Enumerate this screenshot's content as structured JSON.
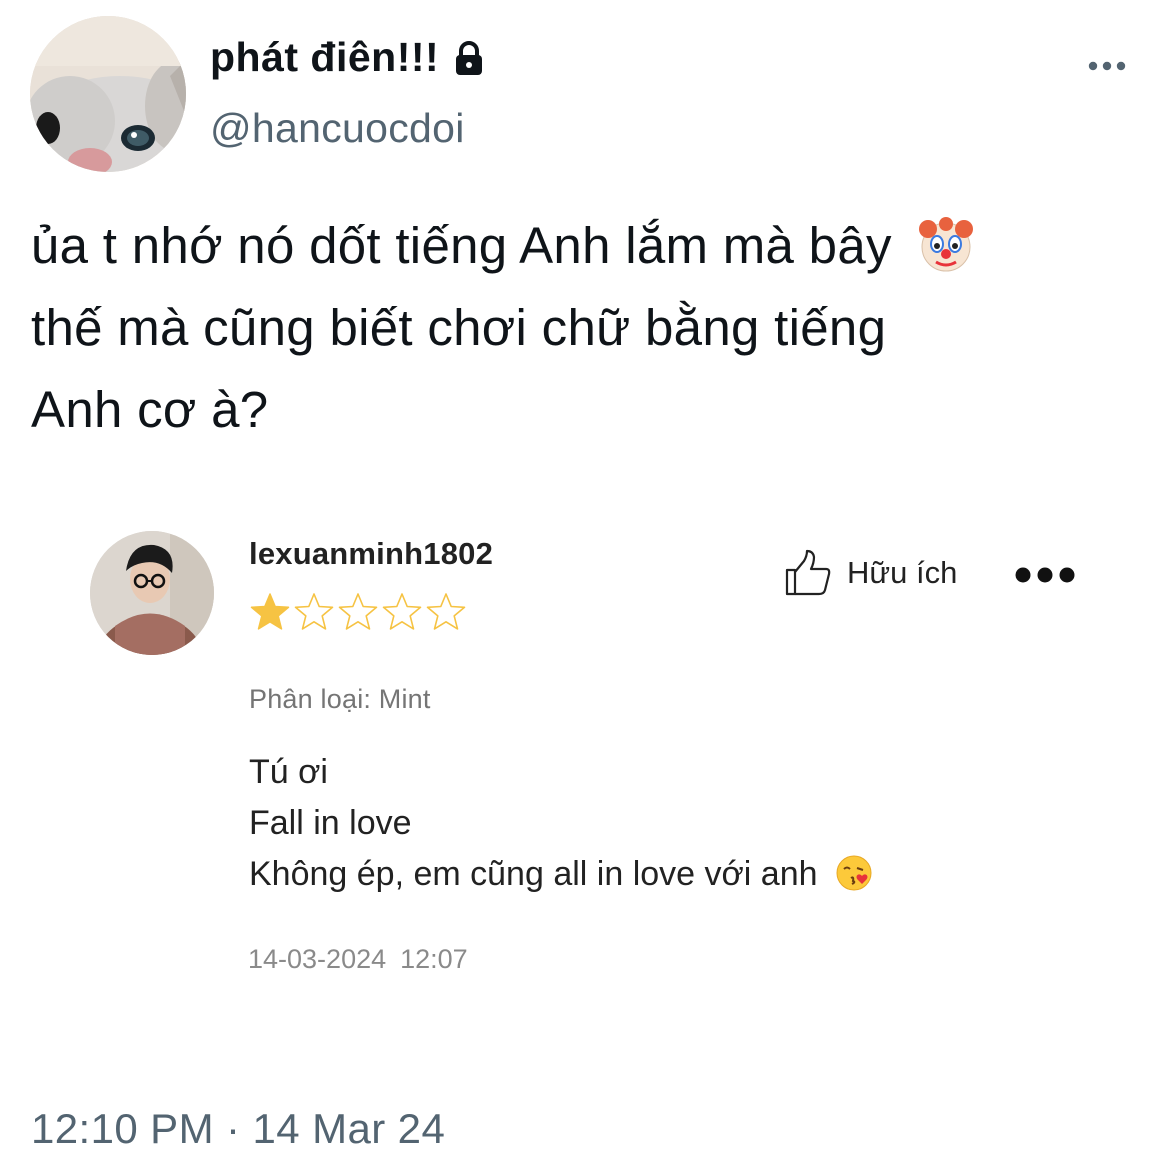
{
  "tweet": {
    "display_name": "phát điên!!!",
    "handle": "@hancuocdoi",
    "text_lines": [
      "ủa t nhớ nó dốt tiếng Anh lắm mà bây",
      "thế mà cũng biết chơi chữ bằng tiếng",
      "Anh cơ à?"
    ],
    "emoji_after_line_1": "clown-face-emoji",
    "timestamp": "12:10 PM · 14 Mar 24",
    "icons": {
      "protected": "lock-icon",
      "menu": "more-horizontal-icon"
    }
  },
  "review": {
    "username": "lexuanminh1802",
    "rating": 1,
    "max_rating": 5,
    "helpful_label": "Hữu ích",
    "variant": "Phân loại: Mint",
    "body_lines": [
      "Tú ơi",
      "Fall in love",
      "Không ép, em cũng all in love với anh"
    ],
    "emoji_after_body": "face-blowing-kiss-emoji",
    "date": "14-03-2024",
    "time": "12:07",
    "colors": {
      "star_filled": "#f6c343",
      "star_empty_stroke": "#f6c343"
    },
    "icons": {
      "helpful": "thumbs-up-icon",
      "menu": "more-horizontal-icon"
    }
  }
}
